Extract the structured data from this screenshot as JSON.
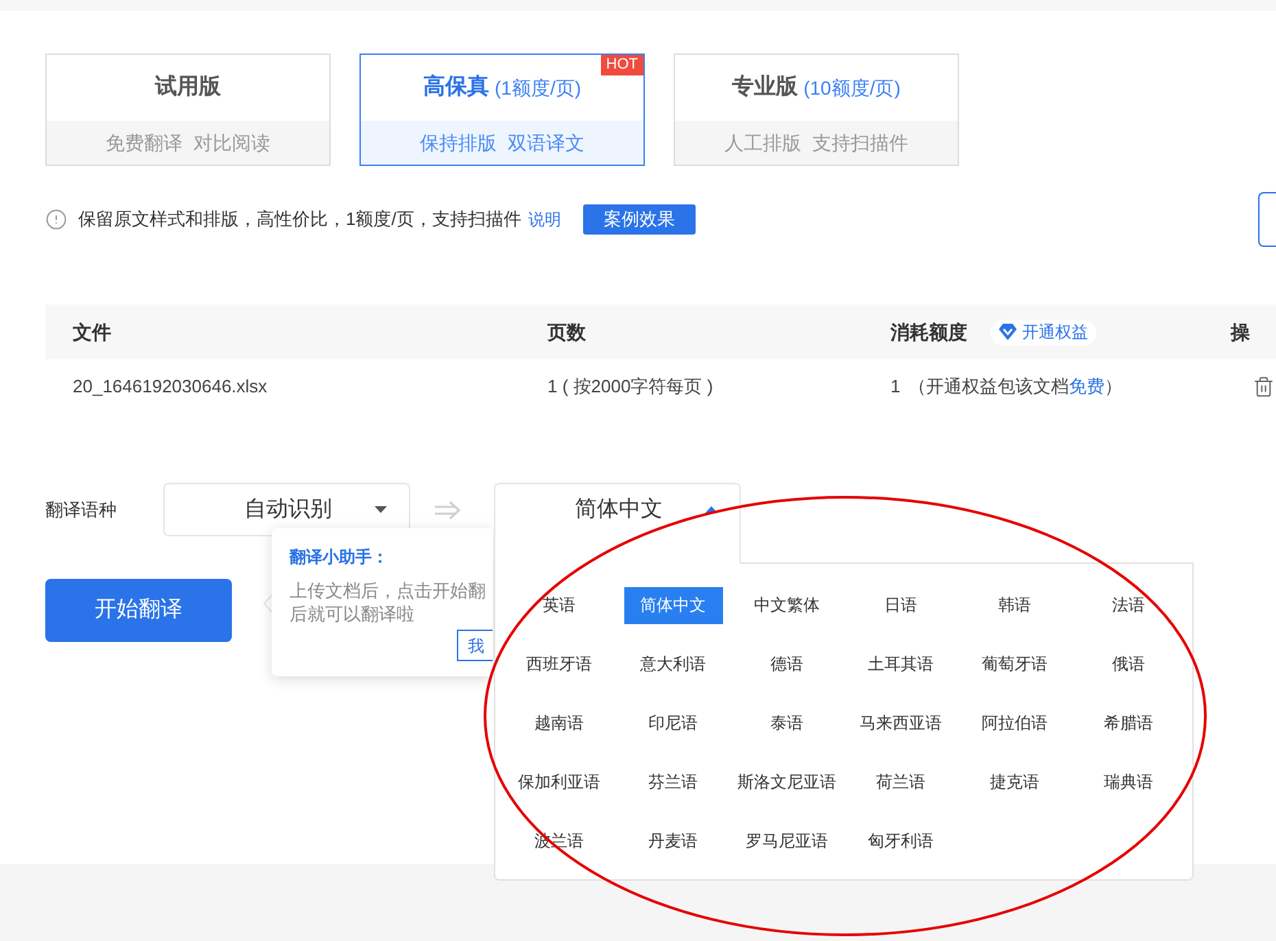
{
  "plans": [
    {
      "title": "试用版",
      "features": [
        "免费翻译",
        "对比阅读"
      ],
      "selected": false
    },
    {
      "title": "高保真",
      "quota": "(1额度/页)",
      "features": [
        "保持排版",
        "双语译文"
      ],
      "selected": true,
      "badge": "HOT"
    },
    {
      "title": "专业版",
      "quota": "(10额度/页)",
      "features": [
        "人工排版",
        "支持扫描件"
      ],
      "selected": false
    }
  ],
  "notice": {
    "text": "保留原文样式和排版，高性价比，1额度/页，支持扫描件",
    "link": "说明",
    "button": "案例效果"
  },
  "table": {
    "columns": [
      {
        "label": "文件"
      },
      {
        "label": "页数"
      },
      {
        "label": "消耗额度",
        "badge": "开通权益"
      },
      {
        "label": "操"
      }
    ],
    "rows": [
      {
        "file": "20_1646192030646.xlsx",
        "pages": "1 ( 按2000字符每页 )",
        "cost": "1",
        "note_before": "（开通权益包该文档",
        "note_link": "免费",
        "note_after": "）"
      }
    ]
  },
  "language": {
    "label": "翻译语种",
    "source": "自动识别",
    "target": "简体中文",
    "expanded": true,
    "options": [
      {
        "label": "英语",
        "selected": false
      },
      {
        "label": "简体中文",
        "selected": true
      },
      {
        "label": "中文繁体",
        "selected": false
      },
      {
        "label": "日语",
        "selected": false
      },
      {
        "label": "韩语",
        "selected": false
      },
      {
        "label": "法语",
        "selected": false
      },
      {
        "label": "西班牙语",
        "selected": false
      },
      {
        "label": "意大利语",
        "selected": false
      },
      {
        "label": "德语",
        "selected": false
      },
      {
        "label": "土耳其语",
        "selected": false
      },
      {
        "label": "葡萄牙语",
        "selected": false
      },
      {
        "label": "俄语",
        "selected": false
      },
      {
        "label": "越南语",
        "selected": false
      },
      {
        "label": "印尼语",
        "selected": false
      },
      {
        "label": "泰语",
        "selected": false
      },
      {
        "label": "马来西亚语",
        "selected": false
      },
      {
        "label": "阿拉伯语",
        "selected": false
      },
      {
        "label": "希腊语",
        "selected": false
      },
      {
        "label": "保加利亚语",
        "selected": false
      },
      {
        "label": "芬兰语",
        "selected": false
      },
      {
        "label": "斯洛文尼亚语",
        "selected": false
      },
      {
        "label": "荷兰语",
        "selected": false
      },
      {
        "label": "捷克语",
        "selected": false
      },
      {
        "label": "瑞典语",
        "selected": false
      },
      {
        "label": "波兰语",
        "selected": false
      },
      {
        "label": "丹麦语",
        "selected": false
      },
      {
        "label": "罗马尼亚语",
        "selected": false
      },
      {
        "label": "匈牙利语",
        "selected": false
      }
    ]
  },
  "start_button": "开始翻译",
  "helper": {
    "title": "翻译小助手：",
    "lines": [
      "上传文档后，点击开始翻",
      "后就可以翻译啦"
    ],
    "button": "我"
  }
}
